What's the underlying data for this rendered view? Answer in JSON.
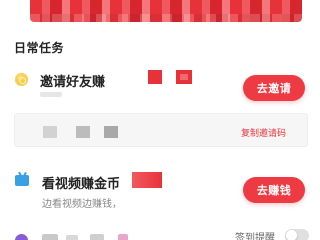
{
  "section": {
    "title": "日常任务"
  },
  "tasks": [
    {
      "title": "邀请好友赚",
      "subtitle": "",
      "button": "去邀请",
      "icon": "coin-icon"
    },
    {
      "title": "看视频赚金币",
      "subtitle": "边看视频边赚钱，",
      "button": "去赚钱",
      "icon": "tv-icon"
    }
  ],
  "invite_code": {
    "copy_label": "复制邀请码"
  },
  "sign": {
    "remind_label": "签到提醒",
    "remind_enabled": false
  },
  "colors": {
    "accent": "#ee3b43",
    "coin": "#f4c12f",
    "tv": "#3aa0e6",
    "purple": "#8a5bd8"
  }
}
